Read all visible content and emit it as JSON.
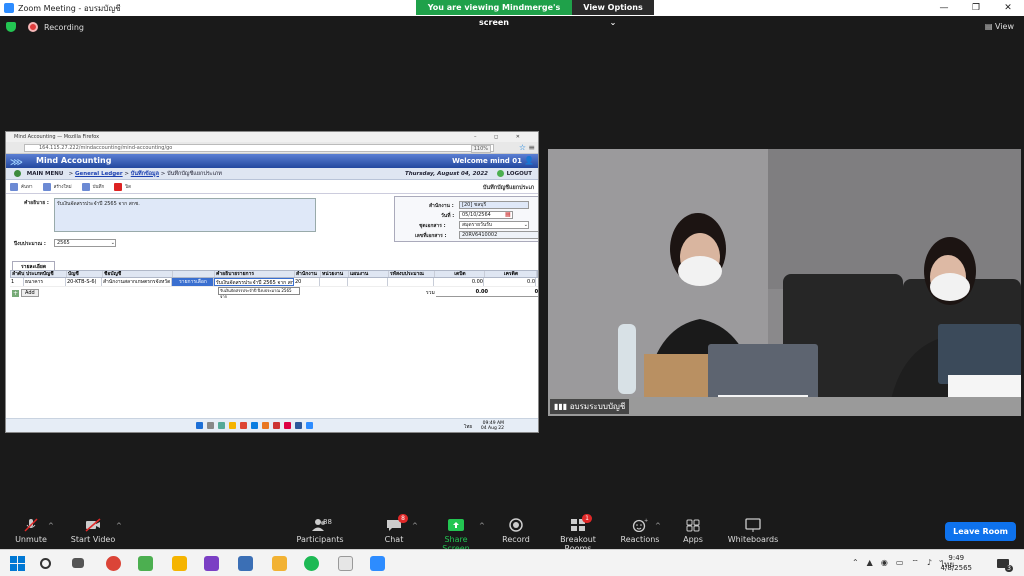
{
  "window": {
    "title": "Zoom Meeting - อบรมบัญชี",
    "controls": [
      "—",
      "❐",
      "✕"
    ]
  },
  "share_banner": {
    "message": "You are viewing Mindmerge's screen",
    "options_label": "View Options ⌄"
  },
  "status": {
    "recording": "Recording",
    "view": "View"
  },
  "shared_screen": {
    "firefox_title": "Mind Accounting — Mozilla Firefox",
    "url": "164.115.27.222/mindaccounting/mind-accounting/go",
    "zoom_level": "110%",
    "app": {
      "brand": "Mind Accounting",
      "welcome": "Welcome mind 01",
      "nav": {
        "main_menu": "MAIN MENU",
        "crumb1": "General Ledger",
        "crumb2": "บันทึกข้อมูล",
        "crumb3": "บันทึกบัญชีแยกประเภท"
      },
      "date": "Thursday, August 04, 2022",
      "logout": "LOGOUT",
      "toolbar": {
        "search": "ค้นหา",
        "new": "สร้างใหม่",
        "save": "บันทึก",
        "close": "ปิด"
      },
      "page_title": "บันทึกบัญชีแยกประเภ",
      "form": {
        "desc_label": "คำอธิบาย :",
        "desc_value": "รับเงินจัดสรรประจำปี 2565 จาก สกช.",
        "fiscal_label": "ปีงบประมาณ :",
        "fiscal_value": "2565",
        "office_label": "สำนักงาน :",
        "office_value": "[20] ชลบุรี",
        "date_label": "วันที่ :",
        "date_value": "05/10/2564",
        "doctype_label": "ชุดเอกสาร :",
        "doctype_value": "สมุดรายวันรับ",
        "docno_label": "เลขที่เอกสาร :",
        "docno_value": "20RV6410002"
      },
      "tab_label": "รายละเอียด",
      "grid": {
        "headers": [
          "ลำดับ",
          "ประเภทบัญชี",
          "บัญชี",
          "ชื่อบัญชี",
          "",
          "คำอธิบายรายการ",
          "สำนักงาน",
          "หน่วยงาน",
          "แผนงาน",
          "รหัสงบประมาณ",
          "เดบิต",
          "เครดิต"
        ],
        "row": [
          "1",
          "ธนาคาร",
          "20-KTB-S-6(",
          "สำนักงานสลากเกษตรกรจังหวัด",
          "รายการเลือก",
          "รับเงินจัดสรรประจำปี 2565 จาก สกช.",
          "20",
          "",
          "",
          "",
          "0.00",
          "0.0"
        ],
        "suggest": "รับเงินจัดสรรประจำปี ปีงบประมาณ 2565 จาก",
        "add_label": "Add",
        "total_label": "รวม",
        "total_debit": "0.00",
        "total_credit": "0."
      },
      "clock": {
        "time": "09:49 AM",
        "date": "04 Aug 22"
      },
      "lang": "ไทย"
    }
  },
  "video": {
    "participant_name": "อบรมระบบบัญชี"
  },
  "toolbar": {
    "unmute": "Unmute",
    "start_video": "Start Video",
    "participants": "Participants",
    "participants_count": "88",
    "chat": "Chat",
    "chat_badge": "8",
    "share_screen": "Share Screen",
    "record": "Record",
    "breakout": "Breakout Rooms",
    "breakout_badge": "1",
    "reactions": "Reactions",
    "apps": "Apps",
    "whiteboards": "Whiteboards",
    "leave": "Leave Room"
  },
  "windows_taskbar": {
    "time": "9:49",
    "date": "4/8/2565",
    "lang": "ไทย",
    "notif": "3"
  },
  "colors": {
    "green": "#1fa14a",
    "zoom_blue": "#0e72ed",
    "share_green": "#23c552",
    "red": "#e02828"
  }
}
